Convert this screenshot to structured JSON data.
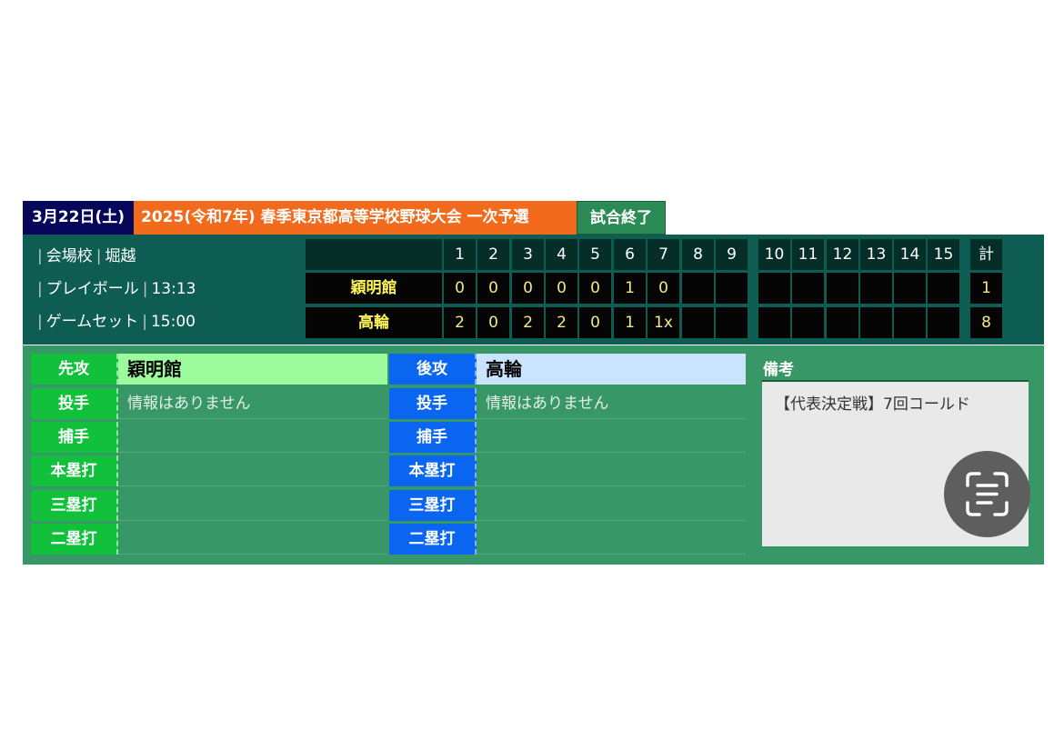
{
  "tabs": {
    "date": "3月22日(土)",
    "tournament": "2025(令和7年) 春季東京都高等学校野球大会 一次予選",
    "status": "試合終了"
  },
  "info": {
    "venue_label": "会場校",
    "venue": "堀越",
    "start_label": "プレイボール",
    "start_time": "13:13",
    "end_label": "ゲームセット",
    "end_time": "15:00"
  },
  "scoreboard": {
    "innings": [
      "1",
      "2",
      "3",
      "4",
      "5",
      "6",
      "7",
      "8",
      "9",
      "10",
      "11",
      "12",
      "13",
      "14",
      "15"
    ],
    "total_label": "計",
    "teams": [
      {
        "name": "穎明館",
        "scores": [
          "0",
          "0",
          "0",
          "0",
          "0",
          "1",
          "0",
          "",
          "",
          "",
          "",
          "",
          "",
          "",
          ""
        ],
        "total": "1"
      },
      {
        "name": "高輪",
        "scores": [
          "2",
          "0",
          "2",
          "2",
          "0",
          "1",
          "1x",
          "",
          "",
          "",
          "",
          "",
          "",
          "",
          ""
        ],
        "total": "8"
      }
    ]
  },
  "details": {
    "first": {
      "label": "先攻",
      "team": "穎明館",
      "rows": [
        {
          "label": "投手",
          "value": "情報はありません"
        },
        {
          "label": "捕手",
          "value": ""
        },
        {
          "label": "本塁打",
          "value": ""
        },
        {
          "label": "三塁打",
          "value": ""
        },
        {
          "label": "二塁打",
          "value": ""
        }
      ]
    },
    "second": {
      "label": "後攻",
      "team": "高輪",
      "rows": [
        {
          "label": "投手",
          "value": "情報はありません"
        },
        {
          "label": "捕手",
          "value": ""
        },
        {
          "label": "本塁打",
          "value": ""
        },
        {
          "label": "三塁打",
          "value": ""
        },
        {
          "label": "二塁打",
          "value": ""
        }
      ]
    },
    "remarks": {
      "title": "備考",
      "text": "【代表決定戦】7回コールド"
    }
  },
  "colors": {
    "date_tab": "#06065a",
    "title_tab": "#f26a1b",
    "status_tab": "#2c8a55",
    "header_bg": "#0d5d52",
    "details_bg": "#389766",
    "first_label": "#12c13b",
    "second_label": "#0a65f0",
    "first_team_bg": "#9cfb9c",
    "second_team_bg": "#c8e4ff"
  },
  "icons": {
    "scan": "text-scan-icon"
  }
}
